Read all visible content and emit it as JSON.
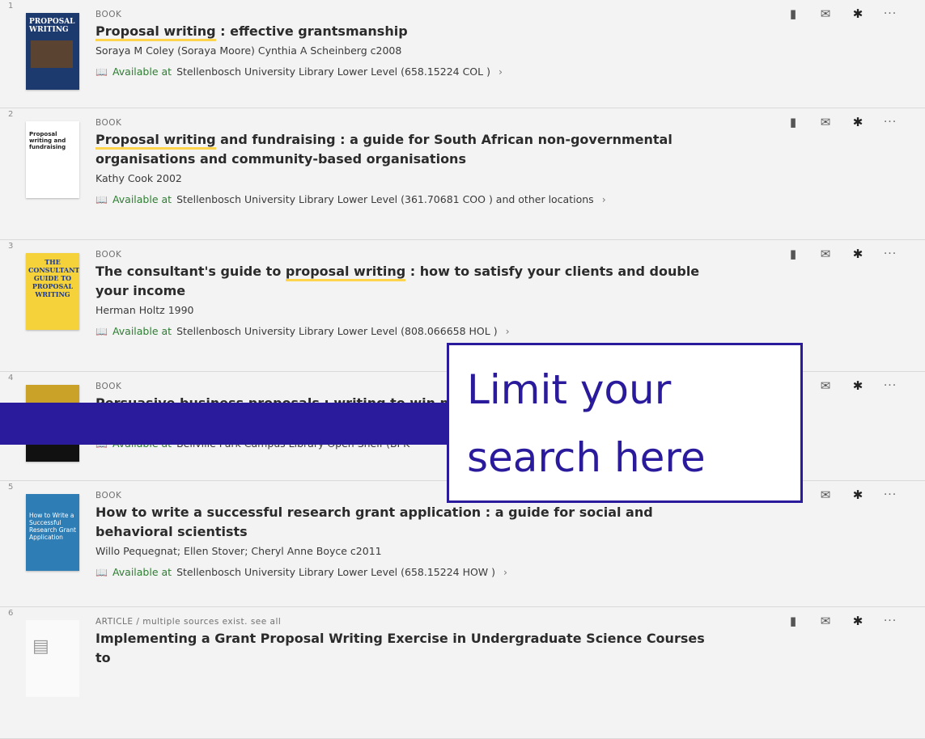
{
  "results": [
    {
      "index": "1",
      "type": "BOOK",
      "title_highlight": "Proposal writing",
      "title_rest": " : effective grantsmanship",
      "authors": "Soraya M Coley (Soraya Moore) Cynthia A Scheinberg c2008",
      "avail_label": "Available at",
      "avail_rest": "Stellenbosch University Library  Lower Level (658.15224 COL )",
      "thumb_text": "PROPOSAL WRITING",
      "thumb_bg": "#1d3a6e"
    },
    {
      "index": "2",
      "type": "BOOK",
      "title_highlight": "Proposal writing",
      "title_rest": " and fundraising : a guide for South African non-governmental organisations and community-based organisations",
      "authors": "Kathy Cook 2002",
      "avail_label": "Available at",
      "avail_rest": "Stellenbosch University Library  Lower Level (361.70681 COO ) and other locations",
      "thumb_text": "Proposal writing and fundraising",
      "thumb_bg": "#ffffff"
    },
    {
      "index": "3",
      "type": "BOOK",
      "title_pre": "The consultant's guide to ",
      "title_highlight": "proposal writing",
      "title_rest": " : how to satisfy your clients and double your income",
      "authors": "Herman Holtz 1990",
      "avail_label": "Available at",
      "avail_rest": "Stellenbosch University Library  Lower Level (808.066658 HOL )",
      "thumb_text": "THE CONSULTANT'S GUIDE TO PROPOSAL WRITING",
      "thumb_bg": "#f5d23a"
    },
    {
      "index": "4",
      "type": "BOOK",
      "title_rest": "Persuasive business proposals : writing to win more customers",
      "avail_label": "Available at",
      "avail_rest": "Bellville Park Campus Library  Open Shelf (BPK",
      "thumb_bg": "#c9a227"
    },
    {
      "index": "5",
      "type": "BOOK",
      "title_rest": "How to write a successful research grant application : a guide for social and behavioral scientists",
      "authors": "Willo Pequegnat; Ellen Stover; Cheryl Anne Boyce c2011",
      "avail_label": "Available at",
      "avail_rest": "Stellenbosch University Library  Lower Level (658.15224 HOW )",
      "thumb_text": "How to Write a Successful Research Grant Application",
      "thumb_bg": "#2f7db5"
    },
    {
      "index": "6",
      "type": "ARTICLE",
      "type_suffix": " / multiple sources exist.",
      "see_all": "see all",
      "title_rest": "Implementing a Grant Proposal Writing Exercise in Undergraduate Science Courses to"
    }
  ],
  "callout": {
    "line1": "Limit your",
    "line2": "search here"
  },
  "colors": {
    "accent": "#2a1a9c",
    "available": "#2e7d32",
    "highlight": "#ffd44d"
  },
  "icons": [
    "printer-icon",
    "mail-icon",
    "pin-icon",
    "more-icon",
    "book-open-icon",
    "chevron-right-icon"
  ]
}
